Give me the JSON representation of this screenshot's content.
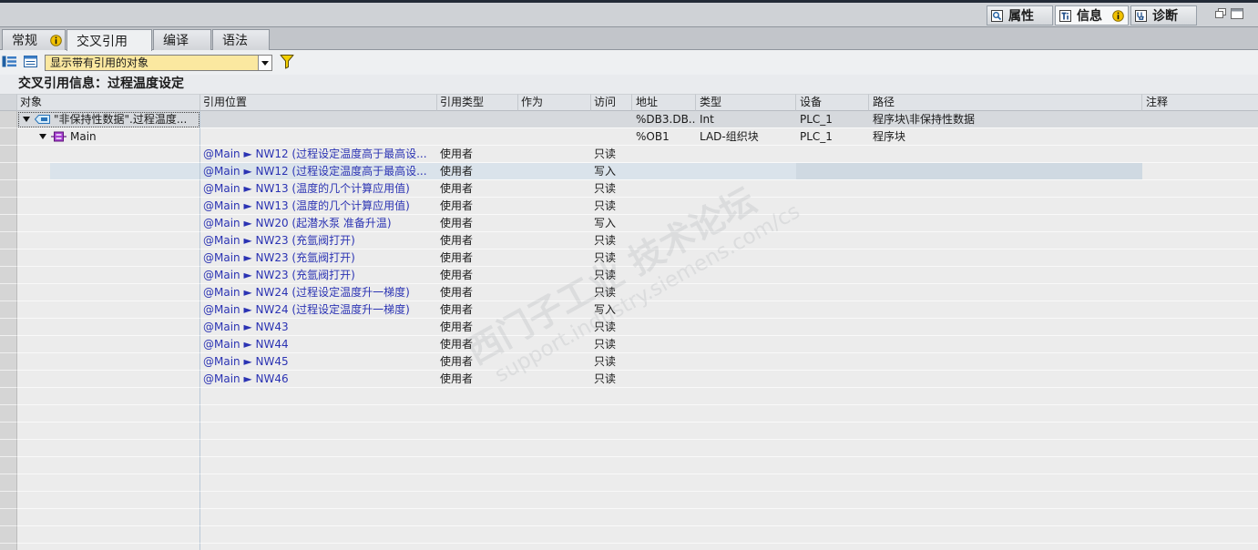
{
  "panel_tabs": [
    {
      "label": "属性",
      "icon": "properties-icon"
    },
    {
      "label": "信息",
      "icon": "info-tab-icon",
      "badge_icon": "info-badge-icon",
      "active": true
    },
    {
      "label": "诊断",
      "icon": "diagnostics-icon"
    }
  ],
  "window_controls": [
    "float-panel-icon",
    "maximize-panel-icon"
  ],
  "tabs": [
    {
      "label": "常规",
      "badge_icon": "info-badge-icon"
    },
    {
      "label": "交叉引用",
      "active": true
    },
    {
      "label": "编译"
    },
    {
      "label": "语法"
    }
  ],
  "toolbar": {
    "icons": [
      "expand-entries-icon",
      "collapse-entries-icon",
      "filter-icon"
    ],
    "filter_select": {
      "value": "显示带有引用的对象"
    }
  },
  "section_title": "交叉引用信息：过程温度设定",
  "columns": [
    "对象",
    "引用位置",
    "引用类型",
    "作为",
    "访问",
    "地址",
    "类型",
    "设备",
    "路径",
    "注释"
  ],
  "objects": [
    {
      "name": "\"非保持性数据\".过程温度...",
      "icon": "data-block-icon",
      "expanded": true,
      "selected": true,
      "address": "%DB3.DB...",
      "type": "Int",
      "device": "PLC_1",
      "path": "程序块\\非保持性数据",
      "children": [
        {
          "name": "Main",
          "icon": "organization-block-icon",
          "expanded": true,
          "address": "%OB1",
          "type": "LAD-组织块",
          "device": "PLC_1",
          "path": "程序块",
          "references": [
            {
              "location": "@Main ► NW12 (过程设定温度高于最高设...",
              "ref_type": "使用者",
              "access": "只读"
            },
            {
              "location": "@Main ► NW12 (过程设定温度高于最高设...",
              "ref_type": "使用者",
              "access": "写入",
              "highlighted": true
            },
            {
              "location": "@Main ► NW13 (温度的几个计算应用值)",
              "ref_type": "使用者",
              "access": "只读"
            },
            {
              "location": "@Main ► NW13 (温度的几个计算应用值)",
              "ref_type": "使用者",
              "access": "只读"
            },
            {
              "location": "@Main ► NW20 (起潜水泵 准备升温)",
              "ref_type": "使用者",
              "access": "写入"
            },
            {
              "location": "@Main ► NW23 (充氩阀打开)",
              "ref_type": "使用者",
              "access": "只读"
            },
            {
              "location": "@Main ► NW23 (充氩阀打开)",
              "ref_type": "使用者",
              "access": "只读"
            },
            {
              "location": "@Main ► NW23 (充氩阀打开)",
              "ref_type": "使用者",
              "access": "只读"
            },
            {
              "location": "@Main ► NW24 (过程设定温度升一梯度)",
              "ref_type": "使用者",
              "access": "只读"
            },
            {
              "location": "@Main ► NW24 (过程设定温度升一梯度)",
              "ref_type": "使用者",
              "access": "写入"
            },
            {
              "location": "@Main ► NW43",
              "ref_type": "使用者",
              "access": "只读"
            },
            {
              "location": "@Main ► NW44",
              "ref_type": "使用者",
              "access": "只读"
            },
            {
              "location": "@Main ► NW45",
              "ref_type": "使用者",
              "access": "只读"
            },
            {
              "location": "@Main ► NW46",
              "ref_type": "使用者",
              "access": "只读"
            }
          ]
        }
      ]
    }
  ],
  "colors": {
    "link": "#2b33b3",
    "filter_select_bg": "#fbe8a0",
    "info_badge": "#f2c200",
    "selected_row": "#d6d9dd",
    "hover_row": "#dae3eb"
  },
  "watermark": {
    "line1": "西门子工业 技术论坛",
    "line2": "support.industry.siemens.com/cs"
  }
}
